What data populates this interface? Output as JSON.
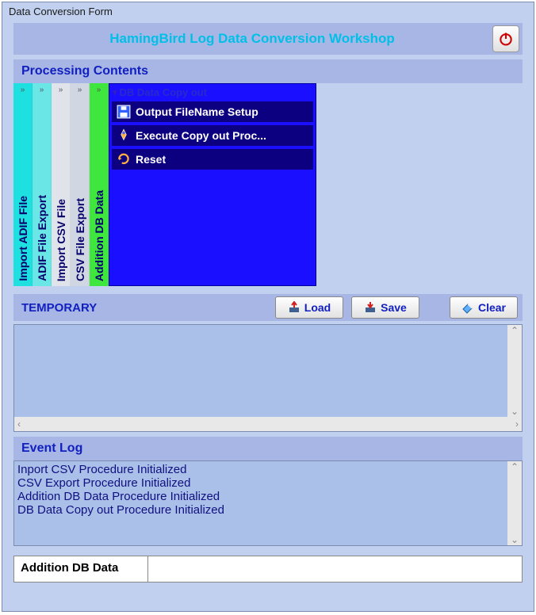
{
  "window": {
    "title": "Data Conversion Form"
  },
  "header": {
    "title": "HamingBird Log Data Conversion Workshop"
  },
  "sections": {
    "processing": "Processing Contents",
    "temporary": "TEMPORARY",
    "eventlog": "Event Log"
  },
  "vtabs": [
    {
      "label": "Import ADIF File"
    },
    {
      "label": "ADIF File Export"
    },
    {
      "label": "Import CSV File"
    },
    {
      "label": "CSV File Export"
    },
    {
      "label": "Addition DB Data"
    }
  ],
  "panel": {
    "title": "DB Data Copy out",
    "items": [
      "Output FileName Setup",
      "Execute Copy out Proc...",
      "Reset"
    ]
  },
  "buttons": {
    "load": "Load",
    "save": "Save",
    "clear": "Clear"
  },
  "temporary_text": "",
  "eventlog_text": "Inport CSV Procedure Initialized\nCSV Export Procedure Initialized\nAddition DB Data Procedure Initialized\nDB Data Copy out Procedure Initialized",
  "status": {
    "cell1": "Addition DB Data",
    "cell2": ""
  }
}
